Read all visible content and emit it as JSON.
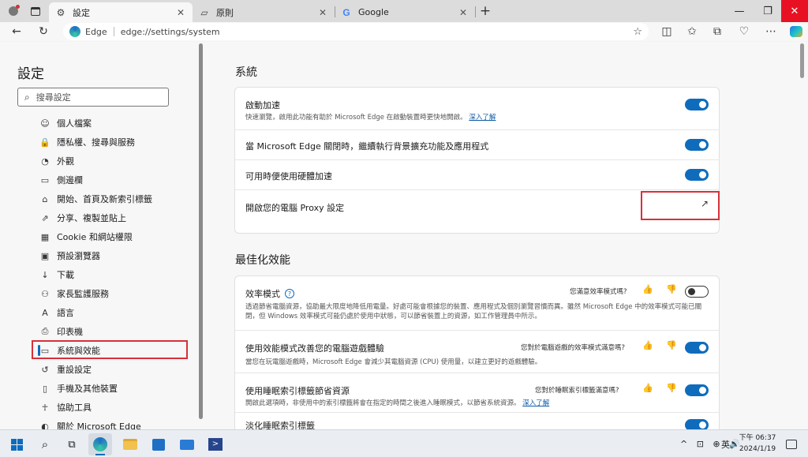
{
  "tabs": [
    {
      "label": "設定",
      "icon": "gear-icon"
    },
    {
      "label": "原則",
      "icon": "tab-page-icon"
    },
    {
      "label": "Google",
      "icon": "google-icon"
    }
  ],
  "new_tab": "+",
  "window_controls": {
    "minimize": "—",
    "restore": "❐",
    "close": "✕"
  },
  "address": {
    "brand": "Edge",
    "url": "edge://settings/system"
  },
  "sidebar": {
    "title": "設定",
    "search_placeholder": "搜尋設定",
    "items": [
      {
        "label": "個人檔案",
        "icon": "profile-icon"
      },
      {
        "label": "隱私權、搜尋與服務",
        "icon": "lock-icon"
      },
      {
        "label": "外觀",
        "icon": "appearance-icon"
      },
      {
        "label": "側邊欄",
        "icon": "sidebar-icon"
      },
      {
        "label": "開始、首頁及新索引標籤",
        "icon": "home-icon"
      },
      {
        "label": "分享、複製並貼上",
        "icon": "share-icon"
      },
      {
        "label": "Cookie 和網站權限",
        "icon": "cookie-icon"
      },
      {
        "label": "預設瀏覽器",
        "icon": "browser-icon"
      },
      {
        "label": "下載",
        "icon": "download-icon"
      },
      {
        "label": "家長監護服務",
        "icon": "family-icon"
      },
      {
        "label": "語言",
        "icon": "language-icon"
      },
      {
        "label": "印表機",
        "icon": "printer-icon"
      },
      {
        "label": "系統與效能",
        "icon": "system-icon"
      },
      {
        "label": "重設設定",
        "icon": "reset-icon"
      },
      {
        "label": "手機及其他裝置",
        "icon": "phone-icon"
      },
      {
        "label": "協助工具",
        "icon": "accessibility-icon"
      },
      {
        "label": "關於 Microsoft Edge",
        "icon": "edge-icon"
      }
    ]
  },
  "system": {
    "heading": "系統",
    "startup_boost": {
      "title": "啟動加速",
      "desc": "快速瀏覽，啟用此功能有助於 Microsoft Edge 在啟動裝置時更快地開啟。",
      "link": "深入了解",
      "enabled": true
    },
    "background_ext": {
      "title": "當 Microsoft Edge 關閉時，繼續執行背景擴充功能及應用程式",
      "enabled": true
    },
    "hw_accel": {
      "title": "可用時便使用硬體加速",
      "enabled": true
    },
    "proxy": {
      "title": "開啟您的電腦 Proxy 設定",
      "icon": "external-link-icon"
    }
  },
  "performance": {
    "heading": "最佳化效能",
    "efficiency": {
      "title": "效率模式",
      "desc": "透過節省電腦資源，協助最大限度地降低用電量。好處可能會根據您的裝置、應用程式及個別瀏覽習慣而異。雖然 Microsoft Edge 中的效率模式可能已關閉，但 Windows 效率模式可能仍處於使用中狀態，可以節省裝置上的資源，如工作管理員中所示。",
      "feedback": "您滿意效率模式嗎?",
      "enabled": false
    },
    "gaming": {
      "title": "使用效能模式改善您的電腦遊戲體驗",
      "desc": "當您在玩電腦遊戲時，Microsoft Edge 會減少其電腦資源 (CPU) 使用量，以建立更好的遊戲體驗。",
      "feedback": "您對於電腦遊戲的效率模式滿意嗎?",
      "enabled": true
    },
    "sleeping_tabs": {
      "title": "使用睡眠索引標籤節省資源",
      "desc": "開啟此選項時，非使用中的索引標籤將會在指定的時間之後進入睡眠模式，以節省系統資源。",
      "link": "深入了解",
      "feedback": "您對於睡眠索引標籤滿意嗎?",
      "enabled": true
    },
    "fade_tabs": {
      "title": "淡化睡眠索引標籤",
      "enabled": true
    }
  },
  "taskbar": {
    "time": "下午 06:37",
    "date": "2024/1/19",
    "ime": "英",
    "tray_icons": "^ ⊡ ⊕ 🔊"
  }
}
